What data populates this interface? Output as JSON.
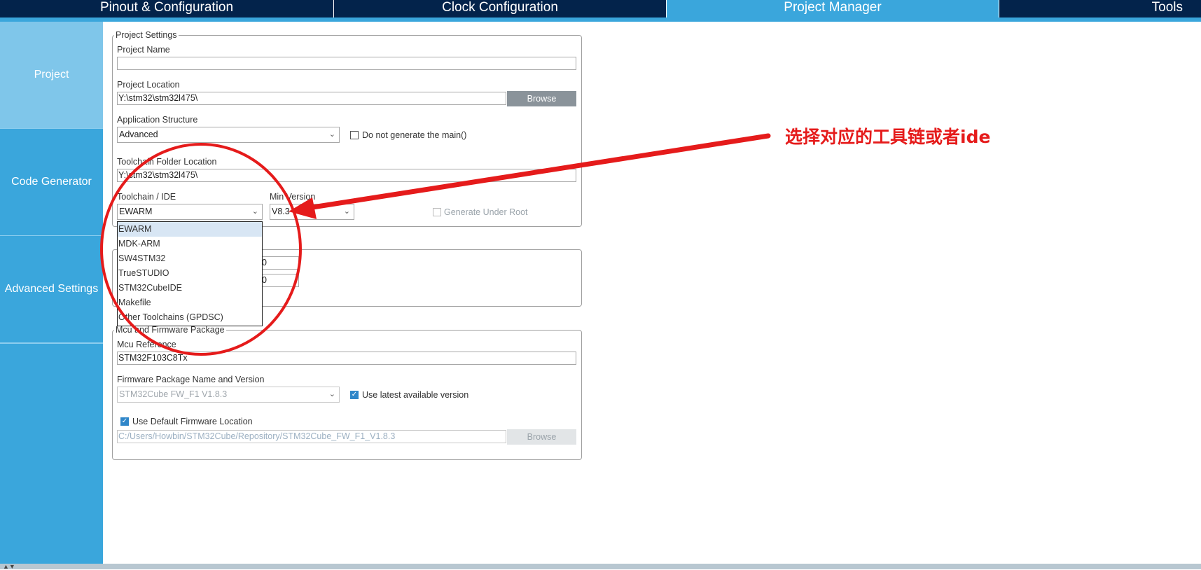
{
  "top_tabs": [
    {
      "label": "Pinout & Configuration"
    },
    {
      "label": "Clock Configuration"
    },
    {
      "label": "Project Manager"
    },
    {
      "label": "Tools"
    }
  ],
  "sidebar": {
    "items": [
      {
        "label": "Project"
      },
      {
        "label": "Code Generator"
      },
      {
        "label": "Advanced Settings"
      }
    ]
  },
  "project_settings": {
    "legend": "Project Settings",
    "project_name_label": "Project Name",
    "project_name_value": "",
    "project_location_label": "Project Location",
    "project_location_value": "Y:\\stm32\\stm32l475\\",
    "browse_label": "Browse",
    "app_structure_label": "Application Structure",
    "app_structure_value": "Advanced",
    "do_not_generate_main_label": "Do not generate the main()",
    "toolchain_folder_label": "Toolchain Folder Location",
    "toolchain_folder_value": "Y:\\stm32\\stm32l475\\",
    "toolchain_ide_label": "Toolchain / IDE",
    "toolchain_ide_value": "EWARM",
    "min_version_label": "Min Version",
    "min_version_value": "V8.3",
    "generate_under_root_label": "Generate Under Root"
  },
  "linker_settings": {
    "value_1": "0",
    "value_2": "0"
  },
  "toolchain_dropdown": {
    "options": [
      "EWARM",
      "MDK-ARM",
      "SW4STM32",
      "TrueSTUDIO",
      "STM32CubeIDE",
      "Makefile",
      "Other Toolchains (GPDSC)"
    ]
  },
  "mcu_firmware": {
    "legend": "Mcu and Firmware Package",
    "mcu_reference_label": "Mcu Reference",
    "mcu_reference_value": "STM32F103C8Tx",
    "firmware_name_label": "Firmware Package Name and Version",
    "firmware_name_value": "STM32Cube FW_F1 V1.8.3",
    "use_latest_label": "Use latest available version",
    "use_default_location_label": "Use Default Firmware Location",
    "firmware_location_value": "C:/Users/Howbin/STM32Cube/Repository/STM32Cube_FW_F1_V1.8.3",
    "browse_label": "Browse"
  },
  "annotation": {
    "text": "选择对应的工具链或者ide",
    "color": "#e51b1b"
  },
  "colors": {
    "top_bar": "#03234b",
    "accent": "#3aa6dc",
    "sidebar_active": "#7fc6ea"
  }
}
